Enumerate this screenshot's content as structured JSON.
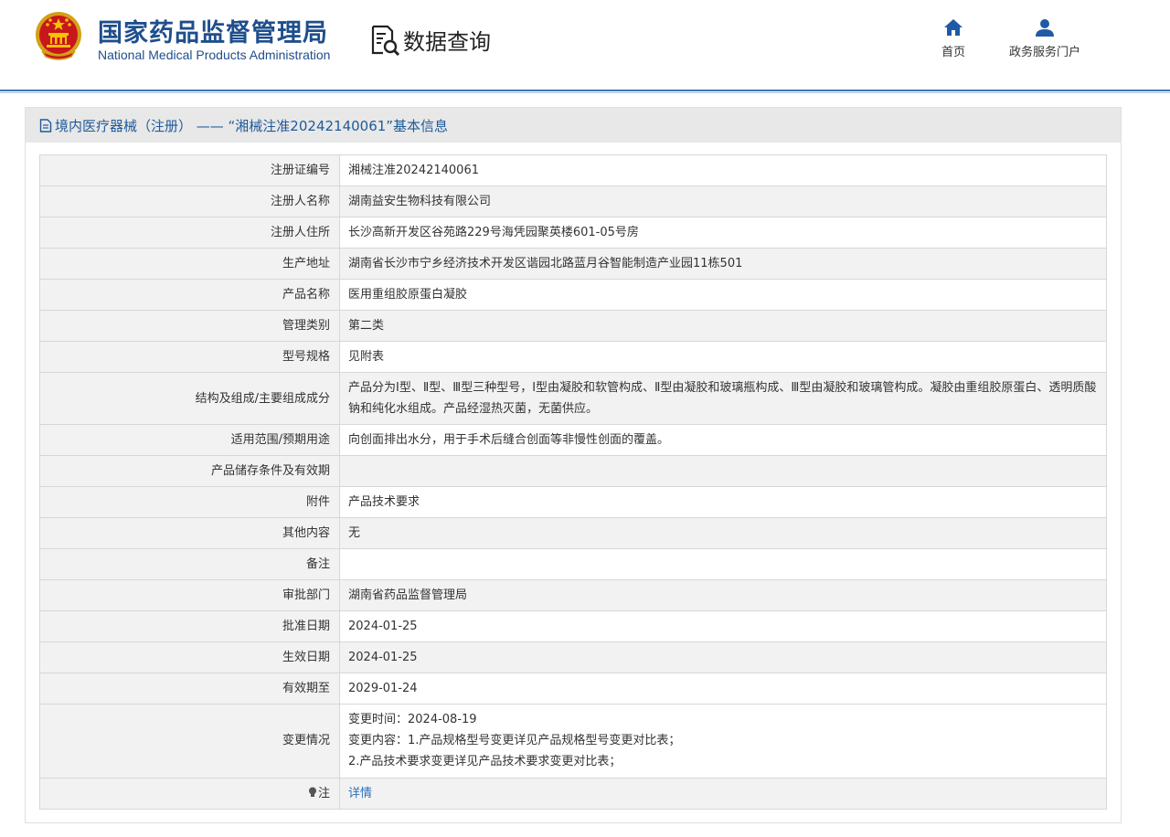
{
  "header": {
    "org_name_cn": "国家药品监督管理局",
    "org_name_en": "National Medical Products Administration",
    "query_label": "数据查询",
    "nav": [
      {
        "label": "首页",
        "icon": "home-icon"
      },
      {
        "label": "政务服务门户",
        "icon": "user-icon"
      }
    ]
  },
  "panel": {
    "title": "境内医疗器械（注册） ——  “湘械注准20242140061”基本信息",
    "icon": "document-icon"
  },
  "details": [
    {
      "label": "注册证编号",
      "value": "湘械注准20242140061"
    },
    {
      "label": "注册人名称",
      "value": "湖南益安生物科技有限公司"
    },
    {
      "label": "注册人住所",
      "value": "长沙高新开发区谷苑路229号海凭园聚英楼601-05号房"
    },
    {
      "label": "生产地址",
      "value": "湖南省长沙市宁乡经济技术开发区谐园北路蓝月谷智能制造产业园11栋501"
    },
    {
      "label": "产品名称",
      "value": "医用重组胶原蛋白凝胶"
    },
    {
      "label": "管理类别",
      "value": "第二类"
    },
    {
      "label": "型号规格",
      "value": "见附表"
    },
    {
      "label": "结构及组成/主要组成成分",
      "value": "产品分为Ⅰ型、Ⅱ型、Ⅲ型三种型号，Ⅰ型由凝胶和软管构成、Ⅱ型由凝胶和玻璃瓶构成、Ⅲ型由凝胶和玻璃管构成。凝胶由重组胶原蛋白、透明质酸钠和纯化水组成。产品经湿热灭菌，无菌供应。"
    },
    {
      "label": "适用范围/预期用途",
      "value": "向创面排出水分，用于手术后缝合创面等非慢性创面的覆盖。"
    },
    {
      "label": "产品储存条件及有效期",
      "value": ""
    },
    {
      "label": "附件",
      "value": "产品技术要求"
    },
    {
      "label": "其他内容",
      "value": "无"
    },
    {
      "label": "备注",
      "value": ""
    },
    {
      "label": "审批部门",
      "value": "湖南省药品监督管理局"
    },
    {
      "label": "批准日期",
      "value": "2024-01-25"
    },
    {
      "label": "生效日期",
      "value": "2024-01-25"
    },
    {
      "label": "有效期至",
      "value": "2029-01-24"
    }
  ],
  "change": {
    "label": "变更情况",
    "lines": [
      "变更时间：2024-08-19",
      "变更内容：1.产品规格型号变更详见产品规格型号变更对比表；",
      "2.产品技术要求变更详见产品技术要求变更对比表；"
    ]
  },
  "note": {
    "label": "注",
    "link_text": "详情",
    "icon": "lightbulb-icon"
  }
}
